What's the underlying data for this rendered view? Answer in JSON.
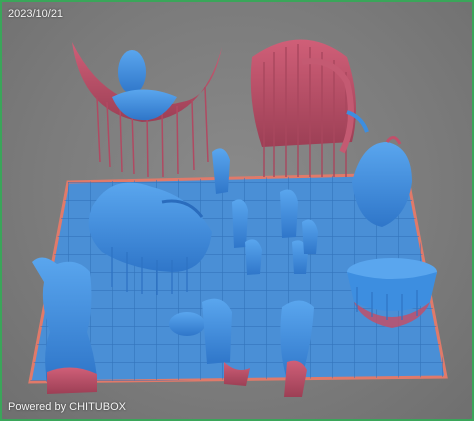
{
  "viewer": {
    "date": "2023/10/21",
    "powered_by": "Powered by CHITUBOX"
  },
  "colors": {
    "background": "#7a7a7a",
    "frame": "#3aa65a",
    "build_plate": "#4a8fd6",
    "plate_grid": "#2f6fb8",
    "plate_edge": "#e07a6a",
    "model_blue": "#3d8ee0",
    "model_red": "#c0506a",
    "model_shadow": "#2a6cbd"
  }
}
